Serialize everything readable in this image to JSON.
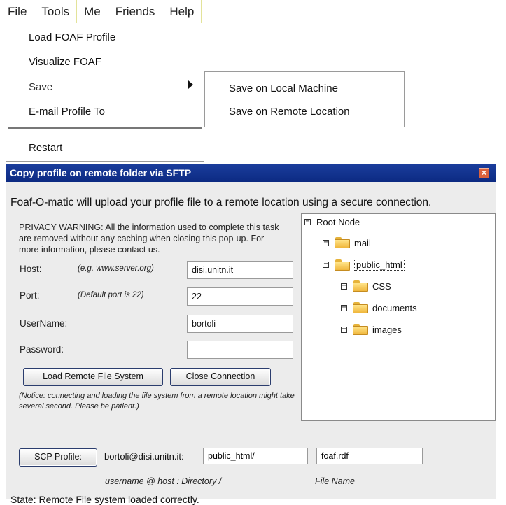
{
  "menubar": {
    "items": [
      "File",
      "Tools",
      "Me",
      "Friends",
      "Help"
    ]
  },
  "file_menu": {
    "load": "Load FOAF Profile",
    "visualize": "Visualize FOAF",
    "save": "Save",
    "email": "E-mail Profile To",
    "restart": "Restart"
  },
  "save_submenu": {
    "local": "Save on Local Machine",
    "remote": "Save on Remote Location"
  },
  "dialog": {
    "title": "Copy profile on remote folder via SFTP",
    "close_glyph": "×",
    "intro": "Foaf-O-matic will upload your profile file to a remote location using a secure connection.",
    "privacy": "PRIVACY WARNING: All the information used to complete this task are removed without any caching when closing this pop-up. For more information, please contact us.",
    "host_label": "Host:",
    "host_hint": "(e.g. www.server.org)",
    "host_value": "disi.unitn.it",
    "port_label": "Port:",
    "port_hint": "(Default port is 22)",
    "port_value": "22",
    "username_label": "UserName:",
    "username_value": "bortoli",
    "password_label": "Password:",
    "password_value": "",
    "load_button": "Load Remote File System",
    "close_conn_button": "Close Connection",
    "notice": "(Notice: connecting and loading the file system from a remote location might take several second. Please be patient.)",
    "tree": {
      "root": "Root Node",
      "mail": "mail",
      "public_html": "public_html",
      "css": "CSS",
      "documents": "documents",
      "images": "images"
    },
    "scp_button": "SCP Profile:",
    "scp_userhost": "bortoli@disi.unitn.it:",
    "directory_value": "public_html/",
    "filename_value": "foaf.rdf",
    "caption_path": "username @ host : Directory /",
    "caption_file": "File Name",
    "state": "State: Remote File system loaded correctly."
  },
  "colors": {
    "titlebar": "#0c2a82",
    "dialog_bg": "#ececec",
    "folder": "#f0b73c",
    "close": "#d9623e"
  }
}
